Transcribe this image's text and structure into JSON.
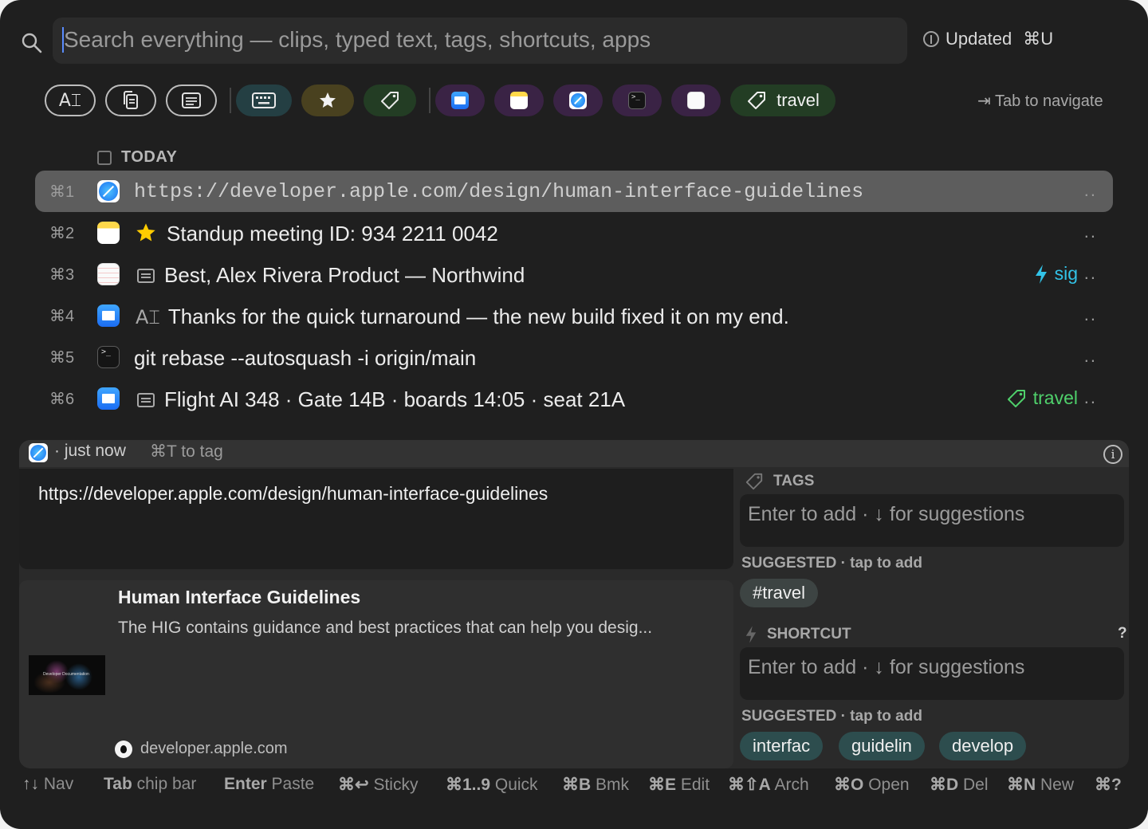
{
  "search": {
    "placeholder": "Search everything — clips, typed text, tags, shortcuts, apps",
    "updated_label": "Updated",
    "updated_shortcut": "⌘U"
  },
  "chip_bar": {
    "type_chips": [
      {
        "icon": "text-cursor-icon",
        "label": "A⌶"
      },
      {
        "icon": "copy-icon"
      },
      {
        "icon": "note-icon"
      }
    ],
    "filter_chips": [
      {
        "icon": "keyboard-icon",
        "color": "#243f43"
      },
      {
        "icon": "star-icon",
        "color": "#49411f"
      },
      {
        "icon": "tag-icon",
        "color": "#233d24"
      }
    ],
    "app_chips": [
      {
        "icon": "mail-app-icon",
        "color": "#3a2345"
      },
      {
        "icon": "notes-app-icon",
        "color": "#3a2345"
      },
      {
        "icon": "safari-app-icon",
        "color": "#3a2345"
      },
      {
        "icon": "terminal-app-icon",
        "color": "#3a2345"
      },
      {
        "icon": "reminders-app-icon",
        "color": "#3a2345"
      }
    ],
    "tag_chip": {
      "label": "travel",
      "color": "#233d24"
    },
    "tab_hint": "⇥ Tab to navigate"
  },
  "list": {
    "section": "TODAY",
    "rows": [
      {
        "key": "⌘1",
        "app": "safari-app-icon",
        "text": "https://developer.apple.com/design/human-interface-guidelines",
        "selected": true,
        "more": ".."
      },
      {
        "key": "⌘2",
        "app": "notes-app-icon",
        "prefix_icon": "star-icon",
        "text": "Standup meeting ID: 934 2211 0042",
        "more": ".."
      },
      {
        "key": "⌘3",
        "app": "reminders-app-icon",
        "prefix_icon": "note-icon",
        "text": "Best, Alex Rivera Product — Northwind",
        "trailing": "sig",
        "trailing_icon": "bolt-icon",
        "trailing_color": "#32c3e8",
        "more": ".."
      },
      {
        "key": "⌘4",
        "app": "mail-app-icon",
        "prefix": "A⌶",
        "text": "Thanks for the quick turnaround — the new build fixed it on my end.",
        "more": ".."
      },
      {
        "key": "⌘5",
        "app": "terminal-app-icon",
        "text": "git rebase --autosquash -i origin/main",
        "more": ".."
      },
      {
        "key": "⌘6",
        "app": "mail-app-icon",
        "prefix_icon": "note-icon",
        "text": "Flight AI 348 · Gate 14B · boards 14:05 · seat 21A",
        "trailing": "travel",
        "trailing_icon": "tag-icon",
        "trailing_color": "#4fd06b",
        "more": ".."
      }
    ]
  },
  "detail": {
    "header_time": "· just now",
    "header_hint": "⌘T to tag",
    "content": "https://developer.apple.com/design/human-interface-guidelines",
    "link_preview": {
      "title": "Human Interface Guidelines",
      "description": "The HIG contains guidance and best practices that can help you desig...",
      "domain": "developer.apple.com",
      "thumb_text": "Developer Documentation"
    },
    "tags": {
      "label": "TAGS",
      "placeholder": "Enter to add · ↓ for suggestions",
      "suggested_label": "SUGGESTED · tap to add",
      "suggestions": [
        "#travel"
      ]
    },
    "shortcut": {
      "label": "SHORTCUT",
      "help": "?",
      "placeholder": "Enter to add · ↓ for suggestions",
      "suggested_label": "SUGGESTED · tap to add",
      "suggestions": [
        "interfac",
        "guidelin",
        "develop"
      ]
    }
  },
  "footer": [
    {
      "key": "↑↓",
      "label": "Nav"
    },
    {
      "key": "Tab",
      "label": "chip bar"
    },
    {
      "key": "Enter",
      "label": "Paste"
    },
    {
      "key": "⌘↩",
      "label": "Sticky"
    },
    {
      "key": "⌘1..9",
      "label": "Quick"
    },
    {
      "key": "⌘B",
      "label": "Bmk"
    },
    {
      "key": "⌘E",
      "label": "Edit"
    },
    {
      "key": "⌘⇧A",
      "label": "Arch"
    },
    {
      "key": "⌘O",
      "label": "Open"
    },
    {
      "key": "⌘D",
      "label": "Del"
    },
    {
      "key": "⌘N",
      "label": "New"
    },
    {
      "key": "⌘?",
      "label": ""
    }
  ]
}
